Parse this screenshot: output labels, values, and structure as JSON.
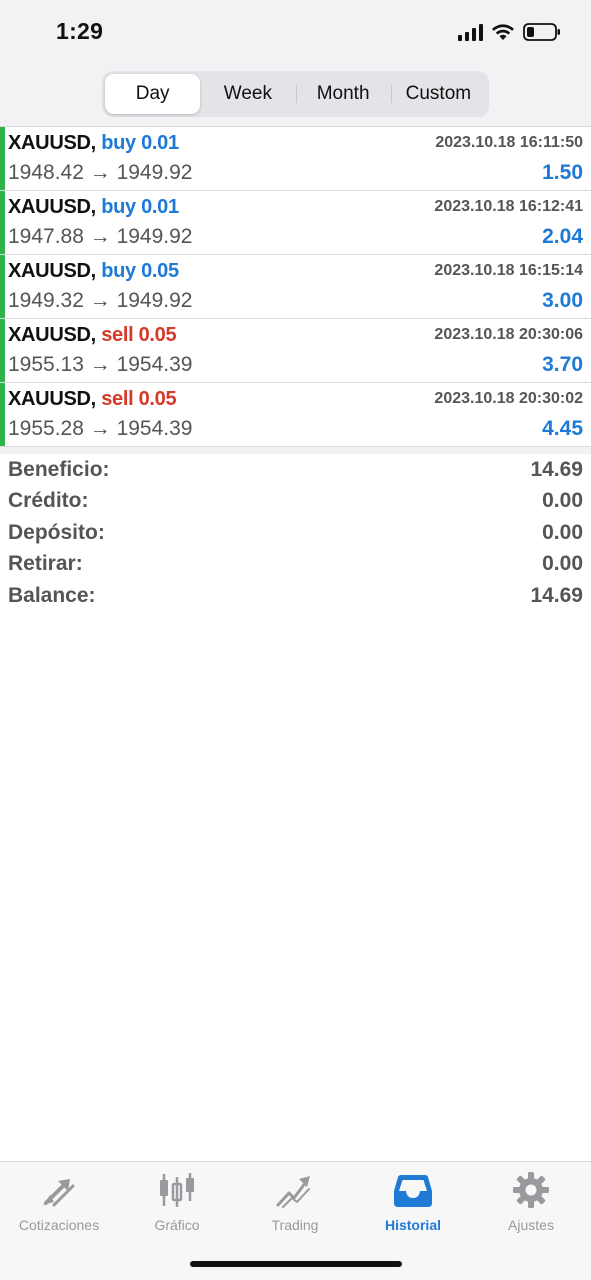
{
  "status_bar": {
    "time": "1:29"
  },
  "period_tabs": [
    {
      "label": "Day",
      "active": true
    },
    {
      "label": "Week",
      "active": false
    },
    {
      "label": "Month",
      "active": false
    },
    {
      "label": "Custom",
      "active": false
    }
  ],
  "deals": [
    {
      "symbol": "XAUUSD,",
      "side": "buy",
      "side_label": "buy 0.01",
      "prices": "1948.42 → 1949.92",
      "time": "2023.10.18 16:11:50",
      "profit": "1.50"
    },
    {
      "symbol": "XAUUSD,",
      "side": "buy",
      "side_label": "buy 0.01",
      "prices": "1947.88 → 1949.92",
      "time": "2023.10.18 16:12:41",
      "profit": "2.04"
    },
    {
      "symbol": "XAUUSD,",
      "side": "buy",
      "side_label": "buy 0.05",
      "prices": "1949.32 → 1949.92",
      "time": "2023.10.18 16:15:14",
      "profit": "3.00"
    },
    {
      "symbol": "XAUUSD,",
      "side": "sell",
      "side_label": "sell 0.05",
      "prices": "1955.13 → 1954.39",
      "time": "2023.10.18 20:30:06",
      "profit": "3.70"
    },
    {
      "symbol": "XAUUSD,",
      "side": "sell",
      "side_label": "sell 0.05",
      "prices": "1955.28 → 1954.39",
      "time": "2023.10.18 20:30:02",
      "profit": "4.45"
    }
  ],
  "summary": [
    {
      "label": "Beneficio:",
      "value": "14.69"
    },
    {
      "label": "Crédito:",
      "value": "0.00"
    },
    {
      "label": "Depósito:",
      "value": "0.00"
    },
    {
      "label": "Retirar:",
      "value": "0.00"
    },
    {
      "label": "Balance:",
      "value": "14.69"
    }
  ],
  "tabbar": [
    {
      "label": "Cotizaciones",
      "icon": "quotes-arrows-icon",
      "active": false
    },
    {
      "label": "Gráfico",
      "icon": "candlestick-chart-icon",
      "active": false
    },
    {
      "label": "Trading",
      "icon": "trading-trend-icon",
      "active": false
    },
    {
      "label": "Historial",
      "icon": "inbox-tray-icon",
      "active": true
    },
    {
      "label": "Ajustes",
      "icon": "gear-icon",
      "active": false
    }
  ],
  "colors": {
    "buy": "#1f7ad6",
    "sell": "#d6392a",
    "profit": "#1f7ad6",
    "deal_bar": "#2fb24a",
    "active_tab": "#1f7ad6",
    "inactive_tab": "#9a9a9e"
  }
}
